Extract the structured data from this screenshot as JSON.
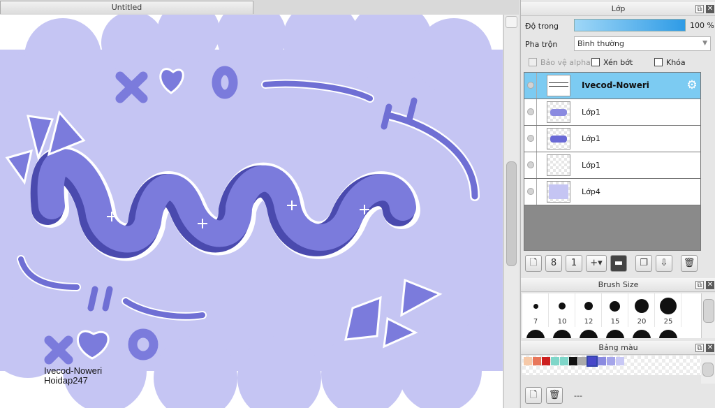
{
  "document": {
    "tab_title": "Untitled"
  },
  "artwork": {
    "main_text": "Ivecod-Noweri",
    "sub_text": "Hoidap247",
    "colors": {
      "cloud": "#c5c5f3",
      "shape": "#7b7bdc",
      "shadow": "#4a4aae",
      "highlight": "#ffffff"
    }
  },
  "layer_panel": {
    "title": "Lớp",
    "opacity_label": "Độ trong",
    "opacity_value": "100 %",
    "blend_label": "Pha trộn",
    "blend_value": "Bình thường",
    "checkboxes": [
      {
        "label": "Bảo vệ alpha",
        "enabled": false
      },
      {
        "label": "Xén bớt",
        "enabled": true
      },
      {
        "label": "Khóa",
        "enabled": true
      }
    ],
    "layers": [
      {
        "name": "Ivecod-Noweri",
        "selected": true,
        "thumb": "text"
      },
      {
        "name": "Lớp1",
        "selected": false,
        "thumb": "art"
      },
      {
        "name": "Lớp1",
        "selected": false,
        "thumb": "art"
      },
      {
        "name": "Lớp1",
        "selected": false,
        "thumb": "sketch"
      },
      {
        "name": "Lớp4",
        "selected": false,
        "thumb": "fill"
      }
    ],
    "accent_color": "#7ccbf2"
  },
  "brush_panel": {
    "title": "Brush Size",
    "sizes": [
      "7",
      "10",
      "12",
      "15",
      "20",
      "25"
    ]
  },
  "palette_panel": {
    "title": "Bảng màu",
    "name": "---",
    "swatches": [
      "#f6c9a8",
      "#e8765a",
      "#cc1f1f",
      "#7fd6c9",
      "#7fd6c9",
      "#111111",
      "#aaaaaa",
      "#4747c9",
      "#8a8ae0",
      "#a5a5ea",
      "#c8c8f5"
    ]
  }
}
